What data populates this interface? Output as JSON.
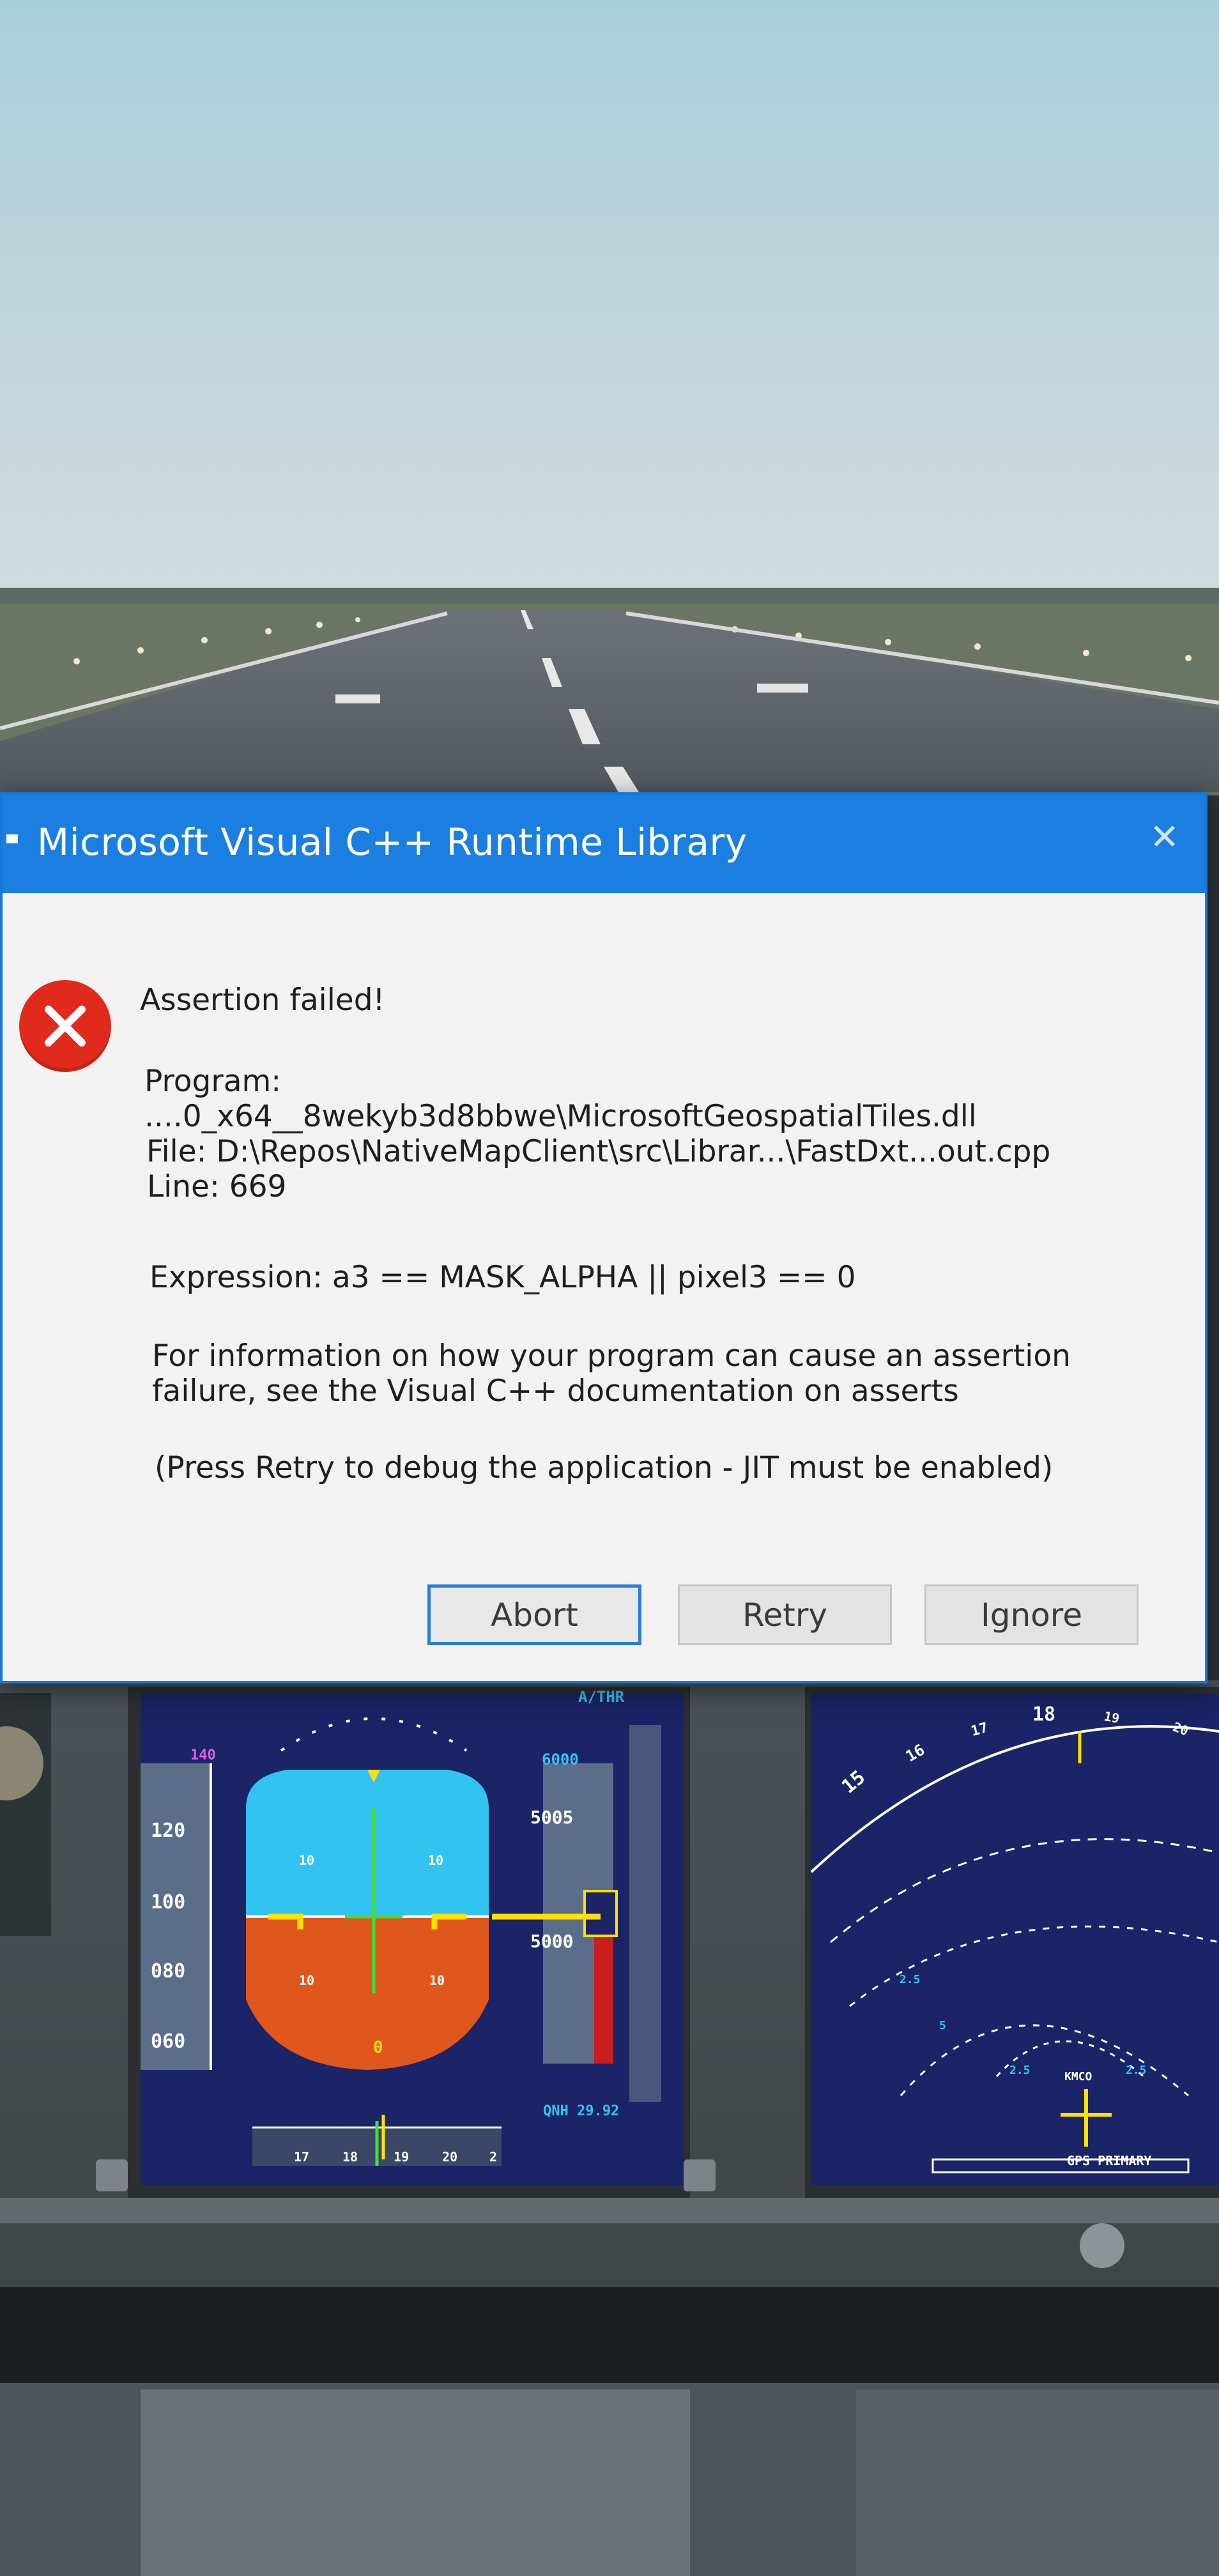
{
  "dialog": {
    "title": "Microsoft Visual C++ Runtime Library",
    "close_glyph": "✕",
    "error_icon": "error-x-icon",
    "heading": "Assertion failed!",
    "program_label": "Program:",
    "program_path": "....0_x64__8wekyb3d8bbwe\\MicrosoftGeospatialTiles.dll",
    "file_line": "File: D:\\Repos\\NativeMapClient\\src\\Librar...\\FastDxt...out.cpp",
    "line_line": "Line: 669",
    "expression_line": "Expression: a3 == MASK_ALPHA || pixel3 == 0",
    "info_line_1": "For information on how your program can cause an assertion",
    "info_line_2": "failure, see the Visual C++ documentation on asserts",
    "press_retry_line": "(Press Retry to debug the application - JIT must be enabled)",
    "buttons": {
      "abort": "Abort",
      "retry": "Retry",
      "ignore": "Ignore"
    }
  },
  "cockpit": {
    "athr": "A/THR",
    "speed_ticks": [
      "140",
      "120",
      "100",
      "080",
      "060"
    ],
    "alt_top": "6000",
    "alt_mid": "5005",
    "alt_low": "5000",
    "pitch_ticks": [
      "10",
      "10",
      "10",
      "10"
    ],
    "bank_value": "0",
    "qnh": "QNH 29.92",
    "heading_ticks": [
      "17",
      "18",
      "19",
      "20",
      "2"
    ],
    "nd_headings": [
      "15",
      "16",
      "17",
      "18",
      "19",
      "20"
    ],
    "nd_range_1": "2.5",
    "nd_range_2": "5",
    "nd_waypoint": "KMCO",
    "nd_range_3": "2.5",
    "nd_range_4": "2.5",
    "gps_label": "GPS PRIMARY"
  },
  "colors": {
    "titlebar": "#1a7fe0",
    "error_icon": "#e02a1c",
    "sky": "#a7c9d6",
    "ground": "#e0571c",
    "display_bg": "#1a2466"
  }
}
